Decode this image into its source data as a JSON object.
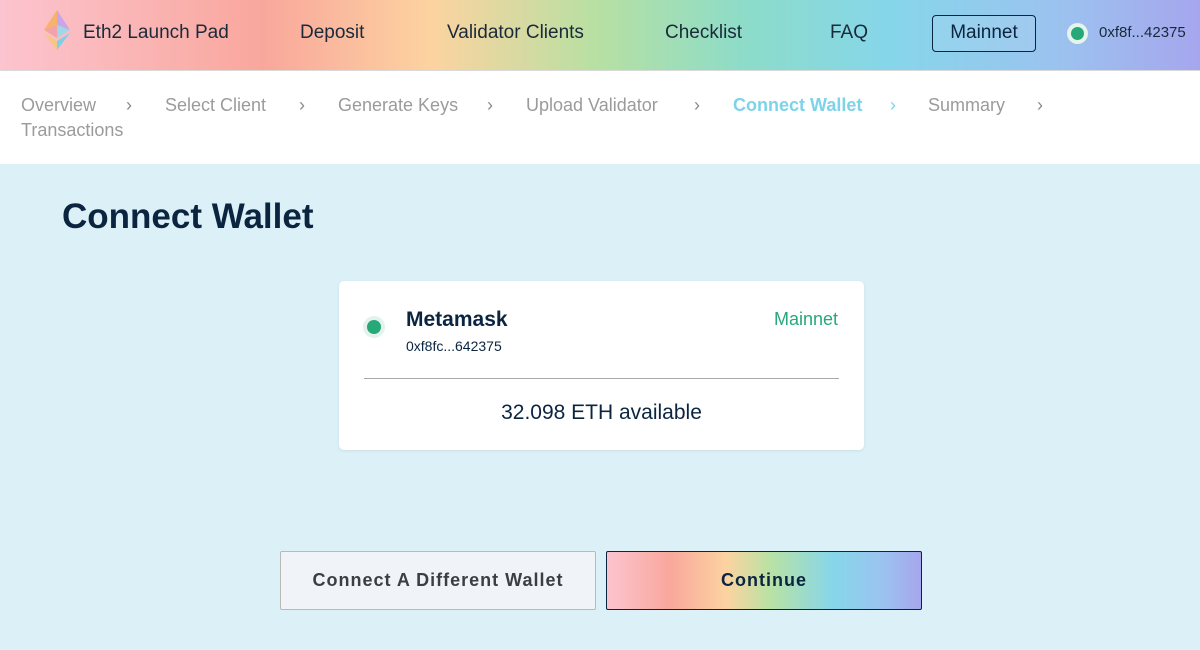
{
  "header": {
    "brand": "Eth2 Launch Pad",
    "nav": [
      "Deposit",
      "Validator Clients",
      "Checklist",
      "FAQ"
    ],
    "network_button": "Mainnet",
    "account_address": "0xf8f...42375",
    "account_status_color": "#26a879"
  },
  "steps": {
    "items": [
      "Overview",
      "Select Client",
      "Generate Keys",
      "Upload Validator",
      "Connect Wallet",
      "Summary",
      "Transactions"
    ],
    "active": "Connect Wallet",
    "separator": "›"
  },
  "main": {
    "title": "Connect Wallet",
    "wallet_card": {
      "name": "Metamask",
      "address": "0xf8fc...642375",
      "network": "Mainnet",
      "balance": "32.098 ETH available",
      "status_color": "#26a879"
    },
    "buttons": {
      "secondary": "Connect A Different Wallet",
      "primary": "Continue"
    }
  },
  "colors": {
    "accent_active_step": "#7dd3e8",
    "background": "#dbf1f7",
    "text_dark": "#0b2540"
  }
}
